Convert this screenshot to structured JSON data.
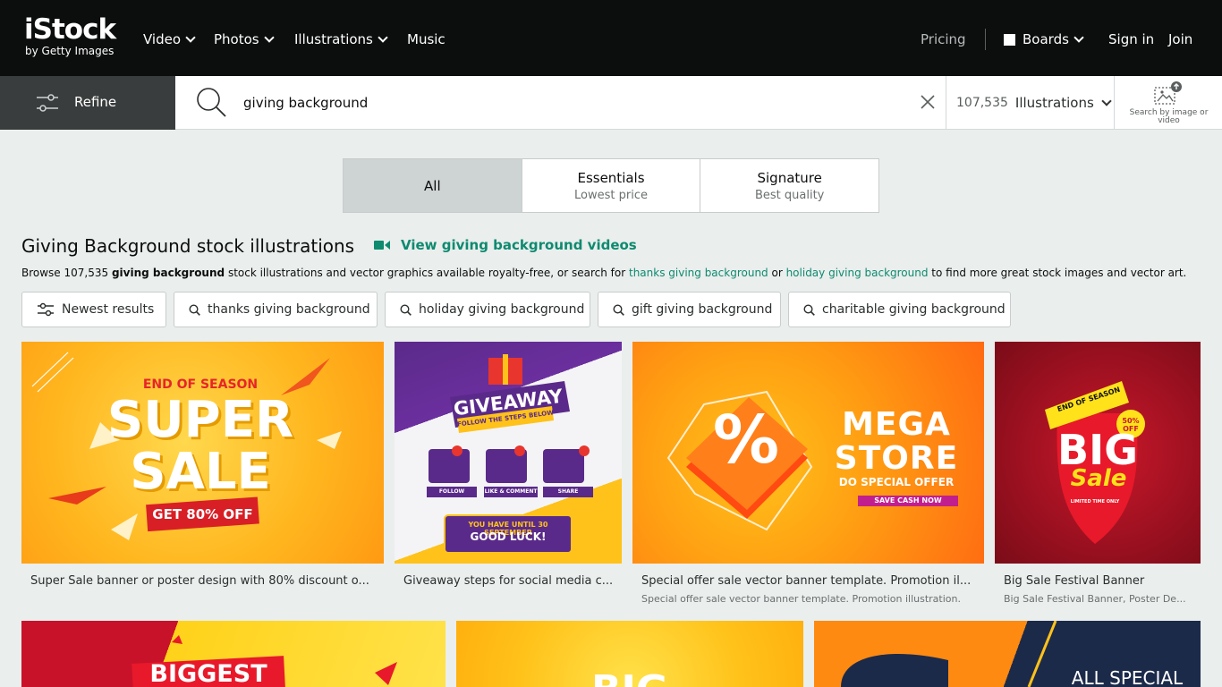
{
  "logo": {
    "main": "iStock",
    "sub": "by Getty Images"
  },
  "nav": {
    "video": "Video",
    "photos": "Photos",
    "illustrations": "Illustrations",
    "music": "Music",
    "pricing": "Pricing",
    "boards": "Boards",
    "signin": "Sign in",
    "join": "Join"
  },
  "refine": {
    "label": "Refine"
  },
  "search": {
    "value": "giving background",
    "count": "107,535",
    "type": "Illustrations",
    "image_search_label": "Search by image or video"
  },
  "tabs": [
    {
      "title": "All",
      "sub": ""
    },
    {
      "title": "Essentials",
      "sub": "Lowest price"
    },
    {
      "title": "Signature",
      "sub": "Best quality"
    }
  ],
  "headline": {
    "title": "Giving Background stock illustrations",
    "videos_link": "View giving background videos"
  },
  "description": {
    "prefix": "Browse 107,535 ",
    "term": "giving background",
    "mid": " stock illustrations and vector graphics available royalty-free, or search for ",
    "link1": "thanks giving background",
    "or": " or ",
    "link2": "holiday giving background",
    "suffix": " to find more great stock images and vector art."
  },
  "chips": [
    "Newest results",
    "thanks giving background",
    "holiday giving background",
    "gift giving background",
    "charitable giving background"
  ],
  "cards": [
    {
      "caption": "Super Sale banner or poster design with 80% discount o...",
      "sub": "",
      "lines": [
        "END OF SEASON",
        "SUPER",
        "SALE",
        "GET 80% OFF"
      ]
    },
    {
      "caption": "Giveaway steps for social media c...",
      "sub": "",
      "lines": [
        "GIVEAWAY",
        "FOLLOW THE STEPS BELOW",
        "FOLLOW",
        "LIKE & COMMENT",
        "SHARE",
        "YOU HAVE UNTIL 30 SEPTEMBER",
        "GOOD LUCK!"
      ]
    },
    {
      "caption": "Special offer sale vector banner template. Promotion il...",
      "sub": "Special offer sale vector banner template. Promotion illustration.",
      "lines": [
        "MEGA",
        "STORE",
        "DO SPECIAL OFFER",
        "SAVE CASH NOW",
        "%"
      ]
    },
    {
      "caption": "Big Sale Festival Banner",
      "sub": "Big Sale Festival Banner, Poster De...",
      "lines": [
        "END OF SEASON",
        "BIG",
        "Sale",
        "50% OFF",
        "LIMITED TIME ONLY"
      ]
    },
    {
      "lines": [
        "BIGGEST"
      ]
    },
    {
      "lines": [
        "BIG"
      ]
    },
    {
      "lines": [
        "ALL SPECIAL"
      ]
    }
  ],
  "colors": {
    "brand_green": "#0e8a6f",
    "header_bg": "#0c0d0d",
    "page_bg": "#eaeeed"
  }
}
